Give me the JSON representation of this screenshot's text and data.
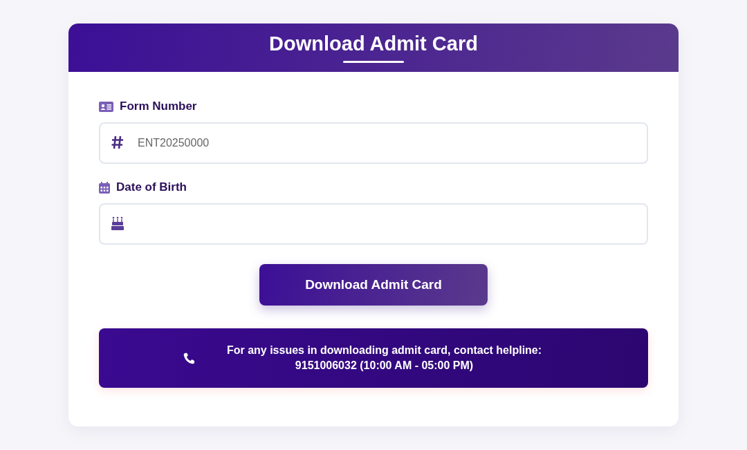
{
  "card": {
    "title": "Download Admit Card"
  },
  "fields": [
    {
      "label": "Form Number",
      "kind": "form",
      "placeholder": "ENT20250000"
    },
    {
      "label": "Date of Birth",
      "kind": "date"
    }
  ],
  "submit_button": "Download Admit Card",
  "helpline": {
    "text": "For any issues in downloading admit card, contact helpline: 9151006032 (10:00 AM - 05:00 PM)"
  }
}
